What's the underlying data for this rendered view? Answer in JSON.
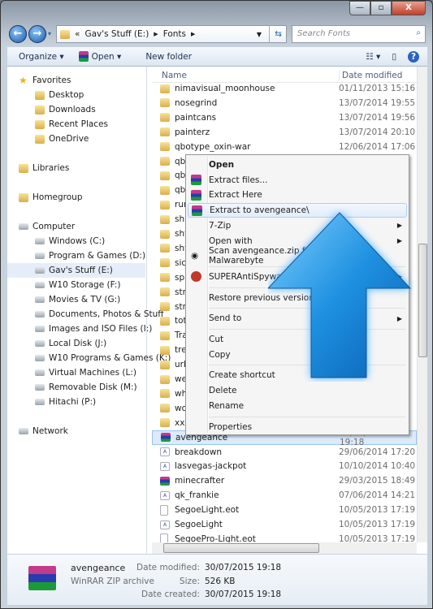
{
  "window": {
    "minimize": "—",
    "maximize": "▫",
    "close": "X"
  },
  "address": {
    "overflow": "«",
    "crumbs": [
      "Gav's Stuff (E:)",
      "Fonts"
    ],
    "search_placeholder": "Search Fonts"
  },
  "toolbar": {
    "organize": "Organize ▾",
    "open": "Open ▾",
    "new_folder": "New folder",
    "help": "?"
  },
  "nav": [
    {
      "label": "Favorites",
      "icon": "star",
      "indent": 0
    },
    {
      "label": "Desktop",
      "icon": "folder",
      "indent": 1
    },
    {
      "label": "Downloads",
      "icon": "folder",
      "indent": 1
    },
    {
      "label": "Recent Places",
      "icon": "folder",
      "indent": 1
    },
    {
      "label": "OneDrive",
      "icon": "folder",
      "indent": 1
    },
    {
      "label": "Libraries",
      "icon": "folder",
      "indent": 0,
      "gap": true
    },
    {
      "label": "Homegroup",
      "icon": "folder",
      "indent": 0,
      "gap": true
    },
    {
      "label": "Computer",
      "icon": "drive",
      "indent": 0,
      "gap": true
    },
    {
      "label": "Windows (C:)",
      "icon": "drive",
      "indent": 1
    },
    {
      "label": "Program & Games (D:)",
      "icon": "drive",
      "indent": 1
    },
    {
      "label": "Gav's Stuff (E:)",
      "icon": "drive",
      "indent": 1,
      "selected": true
    },
    {
      "label": "W10 Storage (F:)",
      "icon": "drive",
      "indent": 1
    },
    {
      "label": "Movies & TV (G:)",
      "icon": "drive",
      "indent": 1
    },
    {
      "label": "Documents, Photos & Stuff",
      "icon": "drive",
      "indent": 1
    },
    {
      "label": "Images and ISO Files (I:)",
      "icon": "drive",
      "indent": 1
    },
    {
      "label": "Local Disk (J:)",
      "icon": "drive",
      "indent": 1
    },
    {
      "label": "W10 Programs & Games (K:)",
      "icon": "drive",
      "indent": 1
    },
    {
      "label": "Virtual Machines (L:)",
      "icon": "drive",
      "indent": 1
    },
    {
      "label": "Removable Disk (M:)",
      "icon": "drive",
      "indent": 1
    },
    {
      "label": "Hitachi (P:)",
      "icon": "drive",
      "indent": 1
    },
    {
      "label": "Network",
      "icon": "drive",
      "indent": 0,
      "gap": true
    }
  ],
  "columns": {
    "name": "Name",
    "date": "Date modified"
  },
  "files": [
    {
      "name": "nimavisual_moonhouse",
      "date": "01/11/2013 15:16",
      "icon": "folder"
    },
    {
      "name": "nosegrind",
      "date": "13/07/2014 19:55",
      "icon": "folder"
    },
    {
      "name": "paintcans",
      "date": "13/07/2014 19:56",
      "icon": "folder"
    },
    {
      "name": "painterz",
      "date": "13/07/2014 20:10",
      "icon": "folder"
    },
    {
      "name": "qbotype_oxin-war",
      "date": "12/06/2014 17:06",
      "icon": "folder"
    },
    {
      "name": "qb",
      "date": "",
      "icon": "folder"
    },
    {
      "name": "qb",
      "date": "",
      "icon": "folder"
    },
    {
      "name": "qb",
      "date": "",
      "icon": "folder"
    },
    {
      "name": "run",
      "date": "",
      "icon": "folder"
    },
    {
      "name": "shr",
      "date": "",
      "icon": "folder"
    },
    {
      "name": "shy",
      "date": "",
      "icon": "folder"
    },
    {
      "name": "shy",
      "date": "",
      "icon": "folder"
    },
    {
      "name": "sick",
      "date": "",
      "icon": "folder"
    },
    {
      "name": "spr",
      "date": "",
      "icon": "folder"
    },
    {
      "name": "stre",
      "date": "",
      "icon": "folder"
    },
    {
      "name": "stre",
      "date": "",
      "icon": "folder"
    },
    {
      "name": "tot",
      "date": "",
      "icon": "folder"
    },
    {
      "name": "Tra",
      "date": "",
      "icon": "folder"
    },
    {
      "name": "tre",
      "date": "",
      "icon": "folder"
    },
    {
      "name": "urb",
      "date": "",
      "icon": "folder"
    },
    {
      "name": "we",
      "date": "",
      "icon": "folder"
    },
    {
      "name": "wh",
      "date": "",
      "icon": "folder"
    },
    {
      "name": "wo",
      "date": "",
      "icon": "folder"
    },
    {
      "name": "xxii",
      "date": "",
      "icon": "folder"
    },
    {
      "name": "avengeance",
      "date": "30/07/2015 19:18",
      "icon": "rar",
      "selected": true
    },
    {
      "name": "breakdown",
      "date": "29/06/2014 17:20",
      "icon": "font"
    },
    {
      "name": "lasvegas-jackpot",
      "date": "10/10/2014 10:40",
      "icon": "font"
    },
    {
      "name": "minecrafter",
      "date": "29/03/2015 18:49",
      "icon": "rar"
    },
    {
      "name": "qk_frankie",
      "date": "07/06/2014 14:21",
      "icon": "font"
    },
    {
      "name": "SegoeLight.eot",
      "date": "10/05/2013 17:19",
      "icon": "doc"
    },
    {
      "name": "SegoeLight",
      "date": "10/05/2013 17:19",
      "icon": "font"
    },
    {
      "name": "SegoePro-Light.eot",
      "date": "10/05/2013 17:19",
      "icon": "doc"
    }
  ],
  "context_menu": [
    {
      "label": "Open",
      "bold": true
    },
    {
      "label": "Extract files...",
      "icon": "rar"
    },
    {
      "label": "Extract Here",
      "icon": "rar"
    },
    {
      "label": "Extract to avengeance\\",
      "icon": "rar",
      "highlighted": true
    },
    {
      "label": "7-Zip",
      "submenu": true
    },
    {
      "label": "Open with",
      "submenu": true
    },
    {
      "label": "Scan avengeance.zip for Viruses with Malwarebyte",
      "icon": "malwarebytes",
      "sep_after": true
    },
    {
      "label": "SUPERAntiSpyware",
      "icon": "superantispyware",
      "submenu": true,
      "sep_after": true
    },
    {
      "label": "Restore previous versions",
      "sep_after": true
    },
    {
      "label": "Send to",
      "submenu": true,
      "sep_after": true
    },
    {
      "label": "Cut"
    },
    {
      "label": "Copy",
      "sep_after": true
    },
    {
      "label": "Create shortcut"
    },
    {
      "label": "Delete"
    },
    {
      "label": "Rename",
      "sep_after": true
    },
    {
      "label": "Properties"
    }
  ],
  "details": {
    "name": "avengeance",
    "type": "WinRAR ZIP archive",
    "modified_label": "Date modified:",
    "modified": "30/07/2015 19:18",
    "size_label": "Size:",
    "size": "526 KB",
    "created_label": "Date created:",
    "created": "30/07/2015 19:18"
  },
  "colors": {
    "arrow": "#1e90e0",
    "selection": "#dcebfc"
  }
}
